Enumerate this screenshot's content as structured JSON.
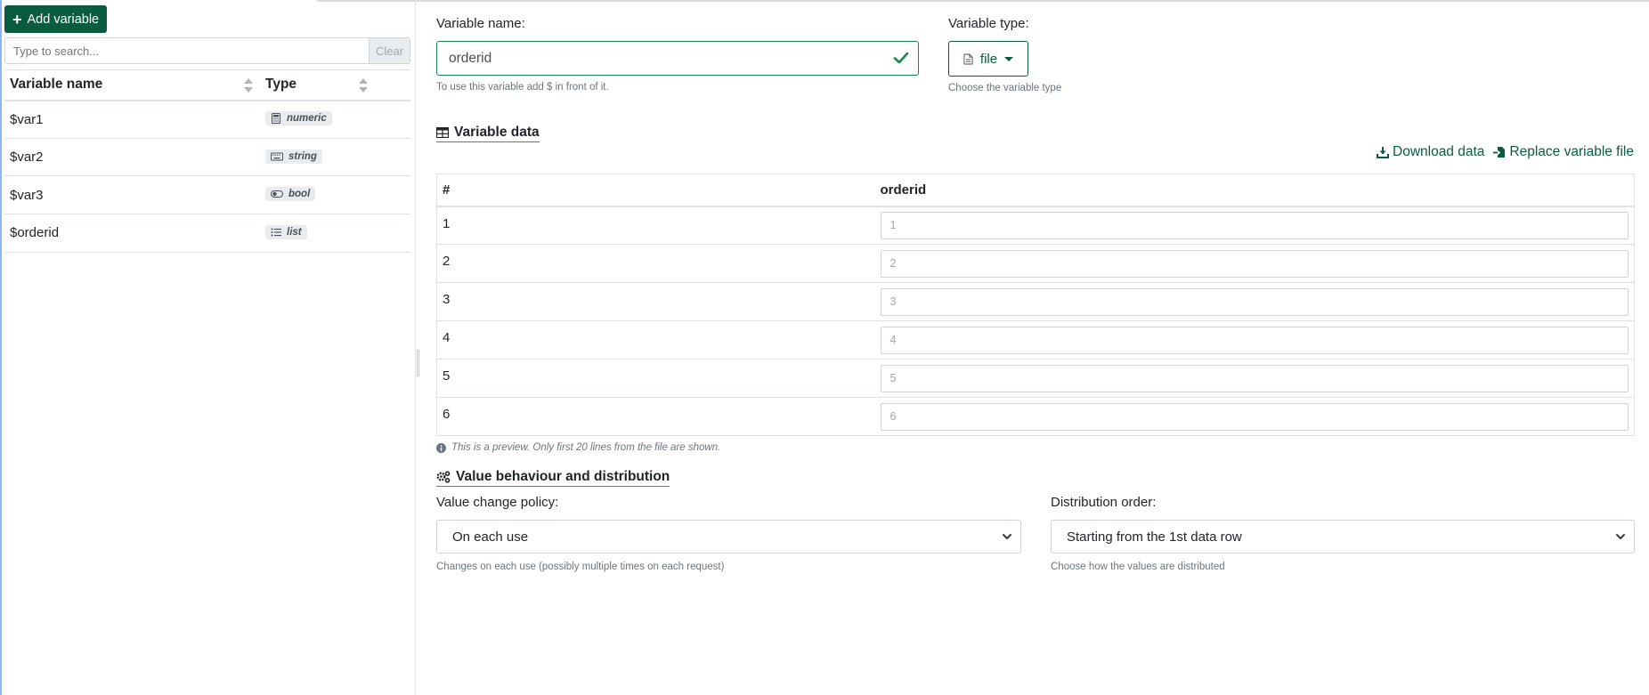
{
  "sidebar": {
    "add_label": "Add variable",
    "search_placeholder": "Type to search...",
    "clear_label": "Clear",
    "columns": {
      "name": "Variable name",
      "type": "Type"
    },
    "variables": [
      {
        "name": "$var1",
        "type": "numeric",
        "icon": "calculator-icon"
      },
      {
        "name": "$var2",
        "type": "string",
        "icon": "keyboard-icon"
      },
      {
        "name": "$var3",
        "type": "bool",
        "icon": "toggle-icon"
      },
      {
        "name": "$orderid",
        "type": "list",
        "icon": "list-icon"
      }
    ]
  },
  "form": {
    "name_label": "Variable name:",
    "name_value": "orderid",
    "name_help": "To use this variable add $ in front of it.",
    "type_label": "Variable type:",
    "type_value": "file",
    "type_help": "Choose the variable type"
  },
  "variable_data": {
    "title": "Variable data",
    "download_label": "Download data",
    "replace_label": "Replace variable file",
    "columns": {
      "index": "#",
      "value": "orderid"
    },
    "rows": [
      {
        "index": "1",
        "placeholder": "1"
      },
      {
        "index": "2",
        "placeholder": "2"
      },
      {
        "index": "3",
        "placeholder": "3"
      },
      {
        "index": "4",
        "placeholder": "4"
      },
      {
        "index": "5",
        "placeholder": "5"
      },
      {
        "index": "6",
        "placeholder": "6"
      }
    ],
    "preview_note": "This is a preview. Only first 20 lines from the file are shown."
  },
  "behaviour": {
    "title": "Value behaviour and distribution",
    "policy_label": "Value change policy:",
    "policy_value": "On each use",
    "policy_help": "Changes on each use (possibly multiple times on each request)",
    "order_label": "Distribution order:",
    "order_value": "Starting from the 1st data row",
    "order_help": "Choose how the values are distributed"
  },
  "colors": {
    "primary": "#0a5c3f",
    "success": "#198754",
    "muted": "#6c757d"
  }
}
